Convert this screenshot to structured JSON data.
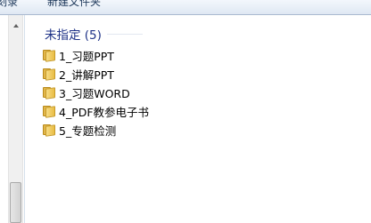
{
  "toolbar": {
    "left_label": "刻录",
    "new_folder_label": "新建文件夹"
  },
  "group": {
    "title": "未指定 (5)"
  },
  "folders": [
    {
      "name": "1_习题PPT",
      "icon": "folder-icon"
    },
    {
      "name": "2_讲解PPT",
      "icon": "folder-icon"
    },
    {
      "name": "3_习题WORD",
      "icon": "folder-icon"
    },
    {
      "name": "4_PDF教参电子书",
      "icon": "folder-icon"
    },
    {
      "name": "5_专题检测",
      "icon": "folder-icon"
    }
  ],
  "colors": {
    "group_title": "#1e3287",
    "folder": "#e9bd45",
    "toolbar_text": "#1e395b"
  }
}
